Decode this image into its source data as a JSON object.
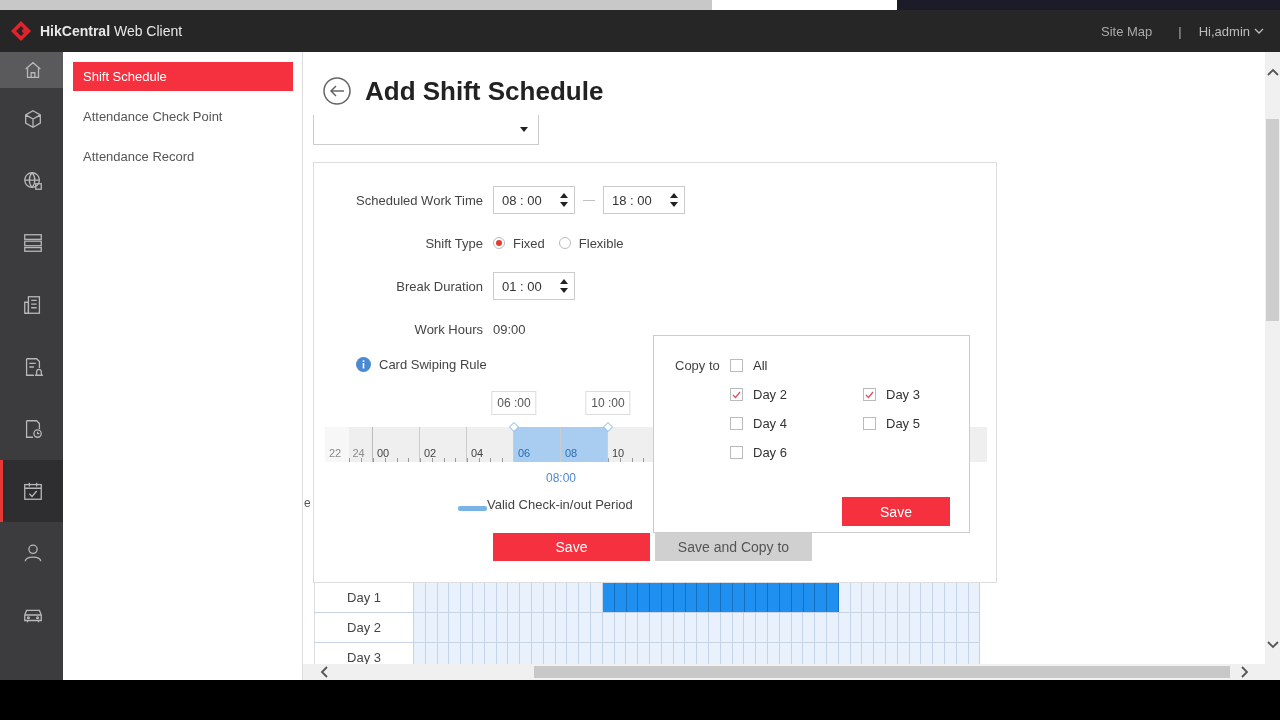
{
  "header": {
    "brand": "**HikCentral** Web Client",
    "links": [
      "Site Map",
      "|"
    ],
    "user": "Hi,admin"
  },
  "rail": [
    {
      "selected": false
    },
    {
      "selected": false
    },
    {
      "selected": false
    },
    {
      "selected": false
    },
    {
      "selected": false
    },
    {
      "selected": false
    },
    {
      "selected": false
    },
    {
      "selected": true
    },
    {
      "selected": false
    },
    {
      "selected": false
    }
  ],
  "submenu": [
    {
      "label": "Shift Schedule",
      "selected": true
    },
    {
      "label": "Attendance Check Point",
      "selected": false
    },
    {
      "label": "Attendance Record",
      "selected": false
    }
  ],
  "page": {
    "title": "Add Shift Schedule"
  },
  "form": {
    "work_time": {
      "label": "Scheduled Work Time",
      "start": "08 : 00",
      "separator": "—",
      "end": "18 : 00"
    },
    "shift_type": {
      "label": "Shift Type",
      "options": [
        {
          "label": "Fixed",
          "selected": true
        },
        {
          "label": "Flexible",
          "selected": false
        }
      ]
    },
    "break_duration": {
      "label": "Break Duration",
      "value": "01 : 00"
    },
    "work_hours": {
      "label": "Work Hours",
      "value": "09:00"
    },
    "card_rule": {
      "label": "Card Swiping Rule"
    }
  },
  "timeline": {
    "ticks": [
      {
        "label": "22",
        "kind": "previous_day",
        "highlighted": false
      },
      {
        "label": "24",
        "kind": "previous_day",
        "highlighted": false
      },
      {
        "label": "00",
        "kind": "day",
        "highlighted": false
      },
      {
        "label": "02",
        "kind": "day",
        "highlighted": false
      },
      {
        "label": "04",
        "kind": "day",
        "highlighted": false
      },
      {
        "label": "06",
        "kind": "day",
        "highlighted": true,
        "handle_label": "06 :00"
      },
      {
        "label": "08",
        "kind": "day",
        "highlighted": true,
        "below_label": "08:00"
      },
      {
        "label": "10",
        "kind": "day",
        "highlighted": false,
        "handle_label": "10 :00"
      }
    ],
    "legend": "Valid Check-in/out Period"
  },
  "edge_text": "e",
  "buttons": [
    {
      "label": "Save",
      "kind": "primary"
    },
    {
      "label": "Save and Copy to",
      "kind": "secondary"
    }
  ],
  "copy_popup": {
    "label": "Copy to",
    "save": "Save",
    "options": [
      {
        "label": "All",
        "checked": false
      },
      {
        "label": "Day 2",
        "checked": true
      },
      {
        "label": "Day 3",
        "checked": true
      },
      {
        "label": "Day 4",
        "checked": false
      },
      {
        "label": "Day 5",
        "checked": false
      },
      {
        "label": "Day 6",
        "checked": false
      }
    ]
  },
  "schedule": {
    "rows": [
      {
        "label": "Day 1",
        "filled": true
      },
      {
        "label": "Day 2",
        "filled": false
      },
      {
        "label": "Day 3",
        "filled": false
      }
    ]
  }
}
